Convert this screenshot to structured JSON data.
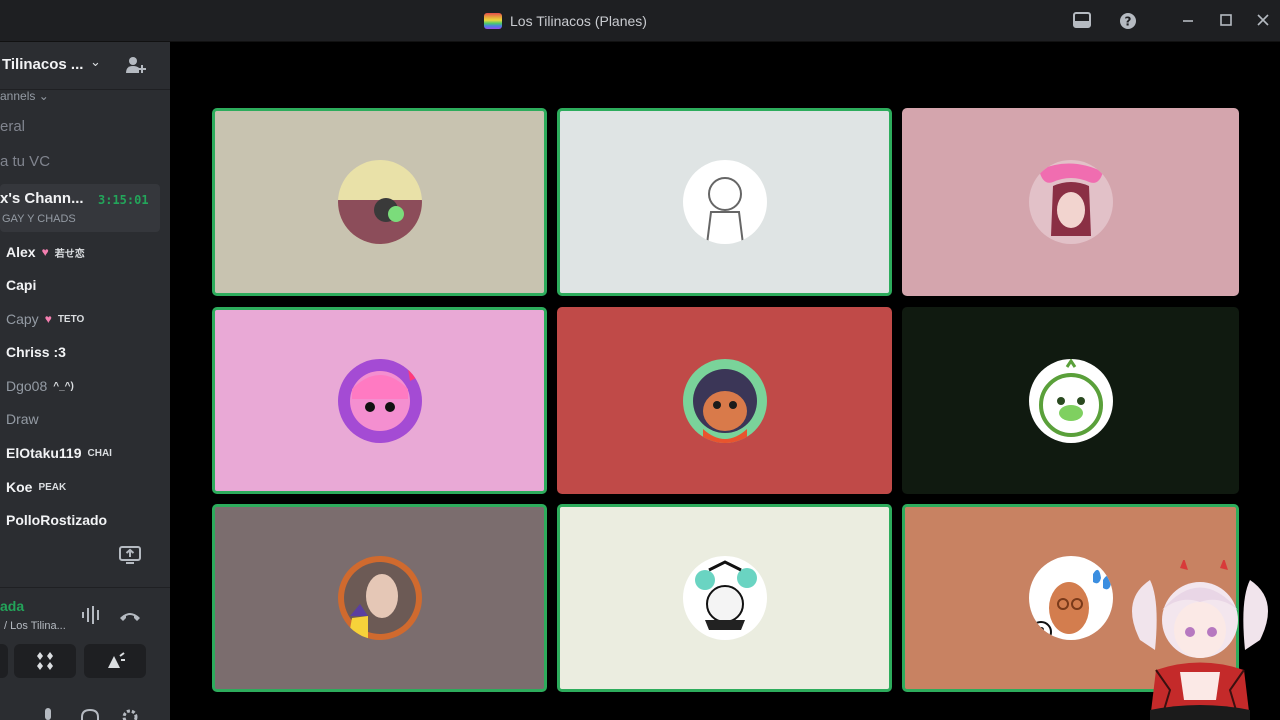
{
  "window": {
    "title": "Los Tilinacos (Planes)"
  },
  "sidebar": {
    "server_name": "Tilinacos ...",
    "category": "annels",
    "channels": [
      "eral",
      "a tu VC"
    ],
    "active_voice": {
      "name": "x's Chann...",
      "timer": "3:15:01",
      "subtitle": "GAY Y CHADS"
    },
    "members": [
      {
        "name": "Alex",
        "badge": "若せ恋",
        "dim": false,
        "heart": true
      },
      {
        "name": "Capi",
        "badge": "",
        "dim": false,
        "heart": false
      },
      {
        "name": "Capy",
        "badge": "TETO",
        "dim": true,
        "heart": true
      },
      {
        "name": "Chriss :3",
        "badge": "",
        "dim": false,
        "heart": false
      },
      {
        "name": "Dgo08",
        "badge": "^_^)",
        "dim": true,
        "heart": false
      },
      {
        "name": "Draw",
        "badge": "",
        "dim": true,
        "heart": false
      },
      {
        "name": "ElOtaku119",
        "badge": "CHAI",
        "dim": false,
        "heart": false
      },
      {
        "name": "Koe",
        "badge": "PEAK",
        "dim": false,
        "heart": false
      },
      {
        "name": "PolloRostizado",
        "badge": "",
        "dim": false,
        "heart": false
      }
    ],
    "voice_panel": {
      "status": "ada",
      "server": "/ Los Tilina..."
    }
  },
  "tiles": [
    {
      "bg": "#c8c3b0",
      "speaking": true
    },
    {
      "bg": "#dfe4e4",
      "speaking": true
    },
    {
      "bg": "#d4a5ad",
      "speaking": false
    },
    {
      "bg": "#e9a9d6",
      "speaking": true
    },
    {
      "bg": "#c04a48",
      "speaking": false
    },
    {
      "bg": "#101a10",
      "speaking": false
    },
    {
      "bg": "#7b6d6e",
      "speaking": true
    },
    {
      "bg": "#ebede0",
      "speaking": true
    },
    {
      "bg": "#c88262",
      "speaking": true
    }
  ],
  "colors": {
    "accent_green": "#23a55a",
    "speaking_border": "#2dac5c"
  }
}
